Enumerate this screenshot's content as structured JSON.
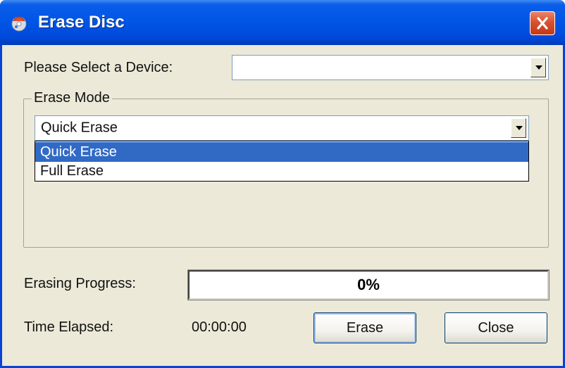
{
  "window": {
    "title": "Erase Disc",
    "close_icon": "close-icon",
    "app_icon": "disc-burner-icon"
  },
  "device": {
    "label": "Please Select a Device:",
    "value": ""
  },
  "erase_mode": {
    "group_label": "Erase Mode",
    "selected": "Quick Erase",
    "options": [
      "Quick Erase",
      "Full Erase"
    ]
  },
  "progress": {
    "label": "Erasing Progress:",
    "percent_text": "0%",
    "value": 0
  },
  "time": {
    "label": "Time Elapsed:",
    "value": "00:00:00"
  },
  "buttons": {
    "erase": "Erase",
    "close": "Close"
  },
  "colors": {
    "titlebar": "#0055e5",
    "selection": "#316ac5",
    "close_button": "#d8522f",
    "window_bg": "#ece9d8"
  }
}
